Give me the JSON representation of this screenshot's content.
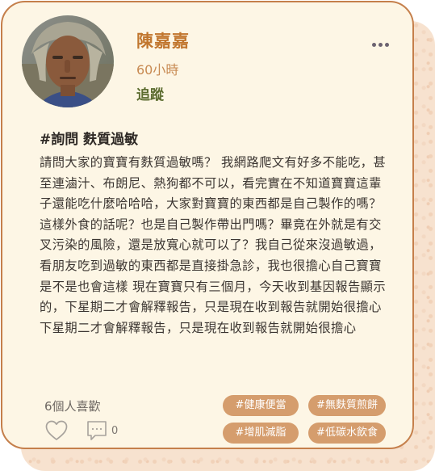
{
  "post": {
    "author_name": "陳嘉嘉",
    "time_ago": "60小時",
    "follow_label": "追蹤",
    "title": "#詢問 麩質過敏",
    "body": "請問大家的寶寶有麩質過敏嗎？ 我網路爬文有好多不能吃，甚至連滷汁、布朗尼、熱狗都不可以，看完實在不知道寶寶這輩子還能吃什麼哈哈哈，大家對寶寶的東西都是自己製作的嗎？ 這樣外食的話呢？也是自己製作帶出門嗎？畢竟在外就是有交叉污染的風險，還是放寬心就可以了？我自己從來沒過敏過，看朋友吃到過敏的東西都是直接掛急診，我也很擔心自己寶寶是不是也會這樣 現在寶寶只有三個月，今天收到基因報告顯示的，下星期二才會解釋報告，只是現在收到報告就開始很擔心下星期二才會解釋報告，只是現在收到報告就開始很擔心"
  },
  "footer": {
    "likes_text": "6個人喜歡",
    "comment_count": "0"
  },
  "tags": [
    "#健康便當",
    "#無麩質煎餅",
    "#增肌減脂",
    "#低碳水飲食"
  ],
  "icons": {
    "more": "more-dots-icon",
    "like": "heart-icon",
    "comment": "comment-icon"
  },
  "colors": {
    "card_bg": "#fdf6e5",
    "border": "#c57f4b",
    "name": "#c1762e",
    "follow": "#5b6b2e",
    "tag_bg": "#d59d6d"
  }
}
